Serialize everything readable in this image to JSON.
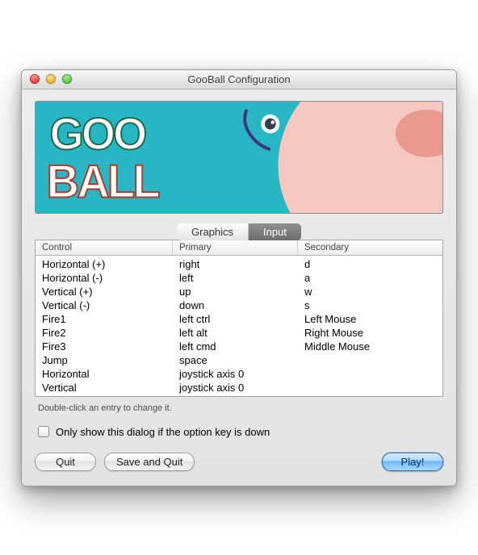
{
  "window": {
    "title": "GooBall Configuration"
  },
  "banner": {
    "logo_top": "GOO",
    "logo_bottom": "BALL"
  },
  "tabs": [
    {
      "label": "Graphics",
      "active": false
    },
    {
      "label": "Input",
      "active": true
    }
  ],
  "table": {
    "headers": {
      "control": "Control",
      "primary": "Primary",
      "secondary": "Secondary"
    },
    "rows": [
      {
        "control": "Horizontal (+)",
        "primary": "right",
        "secondary": "d"
      },
      {
        "control": "Horizontal (-)",
        "primary": "left",
        "secondary": "a"
      },
      {
        "control": "Vertical (+)",
        "primary": "up",
        "secondary": "w"
      },
      {
        "control": "Vertical (-)",
        "primary": "down",
        "secondary": "s"
      },
      {
        "control": "Fire1",
        "primary": "left ctrl",
        "secondary": "Left Mouse"
      },
      {
        "control": "Fire2",
        "primary": "left alt",
        "secondary": "Right Mouse"
      },
      {
        "control": "Fire3",
        "primary": "left cmd",
        "secondary": "Middle Mouse"
      },
      {
        "control": "Jump",
        "primary": "space",
        "secondary": ""
      },
      {
        "control": "Horizontal",
        "primary": "joystick axis 0",
        "secondary": ""
      },
      {
        "control": "Vertical",
        "primary": "joystick axis 0",
        "secondary": ""
      }
    ],
    "hint": "Double-click an entry to change it."
  },
  "checkbox": {
    "label": "Only show this dialog if the option key is down",
    "checked": false
  },
  "buttons": {
    "quit": "Quit",
    "save_quit": "Save and Quit",
    "play": "Play!"
  }
}
